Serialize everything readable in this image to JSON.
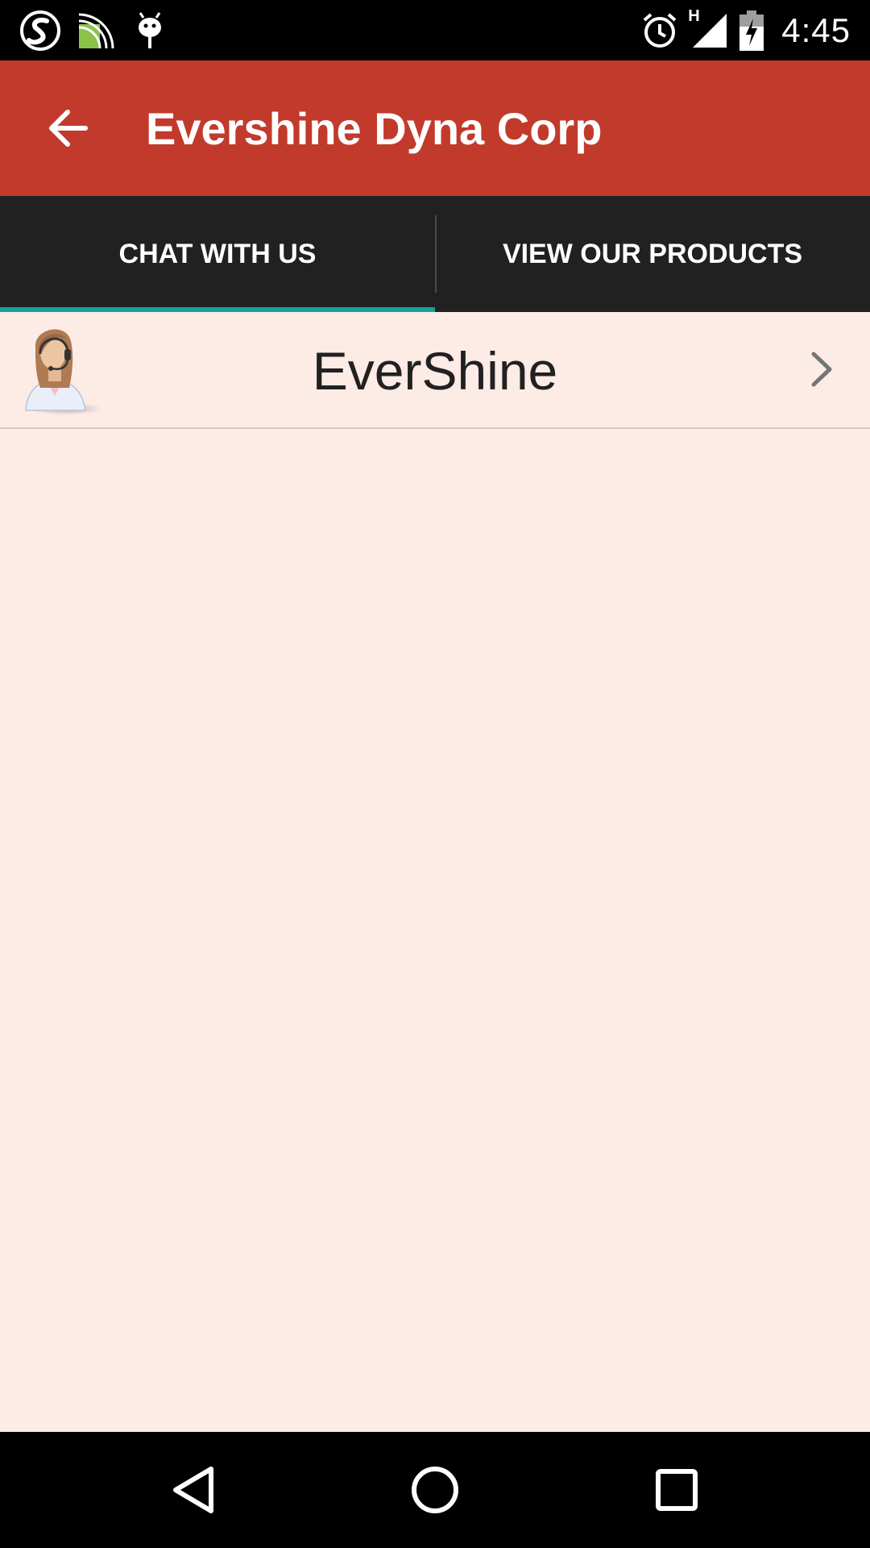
{
  "status_bar": {
    "time": "4:45",
    "network_label": "H",
    "left_icons": [
      "s-app-icon",
      "cast-icon",
      "android-debug-icon"
    ],
    "right_icons": [
      "alarm-icon",
      "signal-icon",
      "battery-charging-icon"
    ]
  },
  "app_bar": {
    "title": "Evershine Dyna Corp",
    "back_icon": "arrow-back-icon",
    "color": "#c23a2c"
  },
  "tabs": [
    {
      "label": "CHAT WITH US",
      "selected": true
    },
    {
      "label": "VIEW OUR PRODUCTS",
      "selected": false
    }
  ],
  "tab_indicator_color": "#17a398",
  "list": {
    "items": [
      {
        "name": "EverShine",
        "avatar": "support-agent-avatar",
        "trailing_icon": "chevron-right-icon"
      }
    ]
  },
  "nav_bar": {
    "buttons": [
      "back-triangle-icon",
      "home-circle-icon",
      "recents-square-icon"
    ]
  },
  "colors": {
    "background": "#fdebe6",
    "tab_bar": "#212121",
    "status_bar": "#000000"
  }
}
